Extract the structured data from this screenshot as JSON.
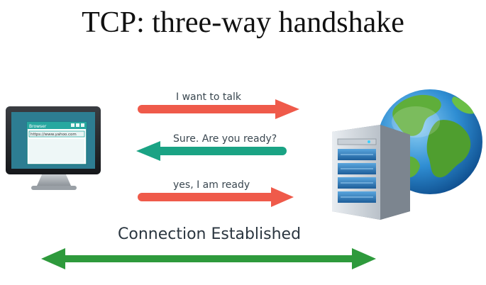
{
  "title": "TCP: three-way handshake",
  "client": {
    "window_title": "Browser",
    "url": "https://www.yahoo.com",
    "icon": "desktop-monitor-icon"
  },
  "server": {
    "icon": "server-tower-icon"
  },
  "globe": {
    "icon": "globe-icon"
  },
  "messages": [
    {
      "label": "I want to talk",
      "direction": "to-server",
      "color": "#ef5a4a"
    },
    {
      "label": "Sure. Are you ready?",
      "direction": "to-client",
      "color": "#1aa384"
    },
    {
      "label": "yes, I am ready",
      "direction": "to-server",
      "color": "#ef5a4a"
    }
  ],
  "connection": {
    "label": "Connection Established",
    "direction": "bidirectional",
    "color": "#2e9a3c"
  }
}
